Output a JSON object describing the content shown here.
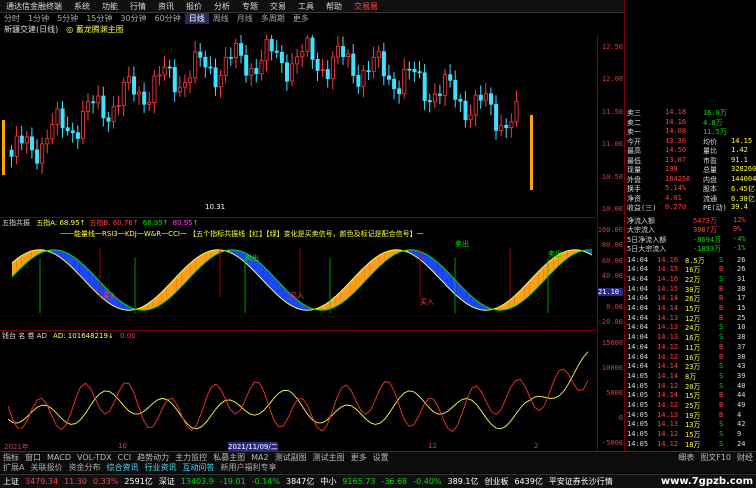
{
  "menu": {
    "app": "通达信金融终端",
    "items": [
      "系统",
      "功能",
      "行情",
      "资讯",
      "报价",
      "分析",
      "专题",
      "交易",
      "工具",
      "帮助"
    ],
    "trade": "交易易"
  },
  "periods": [
    "分时",
    "1分钟",
    "5分钟",
    "15分钟",
    "30分钟",
    "60分钟",
    "日线",
    "周线",
    "月线",
    "多周期",
    "更多"
  ],
  "active_period": 6,
  "title": {
    "stock": "新疆交建(日线)",
    "main": "◎ 蓄龙腾渊主图"
  },
  "main_axis": [
    "12.50",
    "12.00",
    "11.50",
    "11.00",
    "10.50",
    "10.00"
  ],
  "low_label": "10.31",
  "ind1": {
    "name": "五指共振",
    "legend": [
      {
        "text": "五指A: 68.95↑",
        "color": "#ffff40"
      },
      {
        "text": "五指B: 60.76↑",
        "color": "#ff4040"
      },
      {
        "text": "68.95↑",
        "color": "#00e000"
      },
      {
        "text": "80.95↑",
        "color": "#ff40ff"
      }
    ],
    "banner": "一一能量线一RSI3一KDJ一W&R一CCI一 【五个指标共振线【红】【绿】变化是买卖信号，颜色及标记是配合信号】一",
    "axis": [
      "100.00",
      "80.00",
      "60.00",
      "40.00",
      "20.00",
      "0.00",
      "-20.00"
    ],
    "cursor": "21.10",
    "buy": "买入",
    "sell": "卖出"
  },
  "ind2": {
    "name": "钱台 名 卷 AD",
    "value": "101648219↓",
    "ad": "AD: 101648219↓",
    "ma": "0.00",
    "axis": [
      "15000",
      "10000",
      "5000",
      "0",
      "-5000"
    ]
  },
  "dates": {
    "start": "2021年",
    "m1": "10",
    "cursor": "2021/11/09/二",
    "m2": "12",
    "m3": "2"
  },
  "quote": {
    "rows": [
      {
        "l": "卖三",
        "p": "14.18",
        "v": "16.8万",
        "c": "#00e000"
      },
      {
        "l": "卖二",
        "p": "14.16",
        "v": "4.8万",
        "c": "#00e000"
      },
      {
        "l": "卖一",
        "p": "14.08",
        "v": "11.5万",
        "c": "#00e000"
      },
      {
        "l": "今开",
        "p": "13.36",
        "v": "均价",
        "x": "14.15"
      },
      {
        "l": "最高",
        "p": "14.50",
        "v": "量比",
        "x": "1.42"
      },
      {
        "l": "最低",
        "p": "13.07",
        "v": "市盈",
        "x": "91.1"
      },
      {
        "l": "现量",
        "p": "198",
        "v": "总量",
        "x": "328260"
      },
      {
        "l": "外盘",
        "p": "184256",
        "v": "内盘",
        "x": "144004"
      },
      {
        "l": "换手",
        "p": "5.14%",
        "v": "股本",
        "x": "6.45亿"
      },
      {
        "l": "净资",
        "p": "4.01",
        "v": "流通",
        "x": "6.38亿"
      },
      {
        "l": "收益(三)",
        "p": "0.270",
        "v": "PE(动)",
        "x": "39.4"
      }
    ],
    "flows": [
      {
        "l": "净流入额",
        "v": "5473万",
        "x": "12%"
      },
      {
        "l": "大宗流入",
        "v": "3987万",
        "x": "9%"
      },
      {
        "l": "5日净流入额",
        "v": "-8694万",
        "x": "-4%"
      },
      {
        "l": "5日大宗流入",
        "v": "-1853万",
        "x": "-1%"
      }
    ],
    "ticks": [
      [
        "14:04",
        "14.16",
        "8.5万",
        "S",
        "26"
      ],
      [
        "14:04",
        "14.15",
        "16万",
        "B",
        "26"
      ],
      [
        "14:04",
        "14.16",
        "22万",
        "S",
        "31"
      ],
      [
        "14:04",
        "14.15",
        "30万",
        "B",
        "38"
      ],
      [
        "14:04",
        "14.14",
        "26万",
        "B",
        "17"
      ],
      [
        "14:04",
        "14.14",
        "15万",
        "B",
        "15"
      ],
      [
        "14:04",
        "14.13",
        "12万",
        "B",
        "25"
      ],
      [
        "14:04",
        "14.13",
        "24万",
        "S",
        "10"
      ],
      [
        "14:04",
        "14.13",
        "16万",
        "S",
        "38"
      ],
      [
        "14:04",
        "14.12",
        "11万",
        "B",
        "37"
      ],
      [
        "14:04",
        "14.12",
        "16万",
        "B",
        "38"
      ],
      [
        "14:04",
        "14.14",
        "23万",
        "S",
        "43"
      ],
      [
        "14:05",
        "14.14",
        "8万",
        "S",
        "39"
      ],
      [
        "14:05",
        "14.12",
        "20万",
        "S",
        "40"
      ],
      [
        "14:05",
        "14.14",
        "15万",
        "B",
        "44"
      ],
      [
        "14:05",
        "14.12",
        "25万",
        "B",
        "49"
      ],
      [
        "14:05",
        "14.13",
        "19万",
        "B",
        "4"
      ],
      [
        "14:05",
        "14.13",
        "13万",
        "S",
        "42"
      ],
      [
        "14:05",
        "14.12",
        "15万",
        "S",
        "9"
      ],
      [
        "14:05",
        "14.12",
        "18万",
        "S",
        "24"
      ]
    ]
  },
  "bottom_tabs": [
    "指标",
    "窗口",
    "MACD",
    "VOL-TDX",
    "CCI",
    "趋势动力",
    "主力监控",
    "私募主图",
    "MA2",
    "测试副图",
    "测试主图",
    "更多",
    "设置"
  ],
  "bottom_tabs2": [
    "扩展A",
    "关联报价",
    "资金分布",
    "综合资讯",
    "行业资讯",
    "互动问答",
    "新用户福利专享"
  ],
  "right_tabs": [
    "细表",
    "图文F10",
    "财经"
  ],
  "status": [
    {
      "t": "上证",
      "c": "#fff"
    },
    {
      "t": "3479.34",
      "c": "#ff4040"
    },
    {
      "t": "11.30",
      "c": "#ff4040"
    },
    {
      "t": "0.33%",
      "c": "#ff4040"
    },
    {
      "t": "2591亿",
      "c": "#fff"
    },
    {
      "t": "深证",
      "c": "#fff"
    },
    {
      "t": "13403.9",
      "c": "#00e000"
    },
    {
      "t": "-19.01",
      "c": "#00e000"
    },
    {
      "t": "-0.14%",
      "c": "#00e000"
    },
    {
      "t": "3847亿",
      "c": "#fff"
    },
    {
      "t": "中小",
      "c": "#fff"
    },
    {
      "t": "9165.73",
      "c": "#00e000"
    },
    {
      "t": "-36.68",
      "c": "#00e000"
    },
    {
      "t": "-0.40%",
      "c": "#00e000"
    },
    {
      "t": "389.1亿",
      "c": "#fff"
    },
    {
      "t": "创业板",
      "c": "#fff"
    },
    {
      "t": "6439亿",
      "c": "#fff"
    },
    {
      "t": "平安证券长沙行情",
      "c": "#fff"
    }
  ],
  "watermark": "www.7gpzb.com"
}
